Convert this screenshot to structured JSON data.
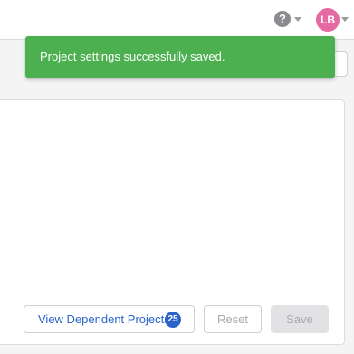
{
  "header": {
    "help_glyph": "?",
    "user_initials": "LB",
    "avatar_color": "#e46aa3"
  },
  "toast": {
    "message": "Project settings successfully saved.",
    "color": "#4caf50"
  },
  "actions": {
    "view_dependents_label": "View Dependent Projects",
    "dependents_count": "25",
    "reset_label": "Reset",
    "save_label": "Save"
  },
  "colors": {
    "link": "#2a64c9"
  }
}
